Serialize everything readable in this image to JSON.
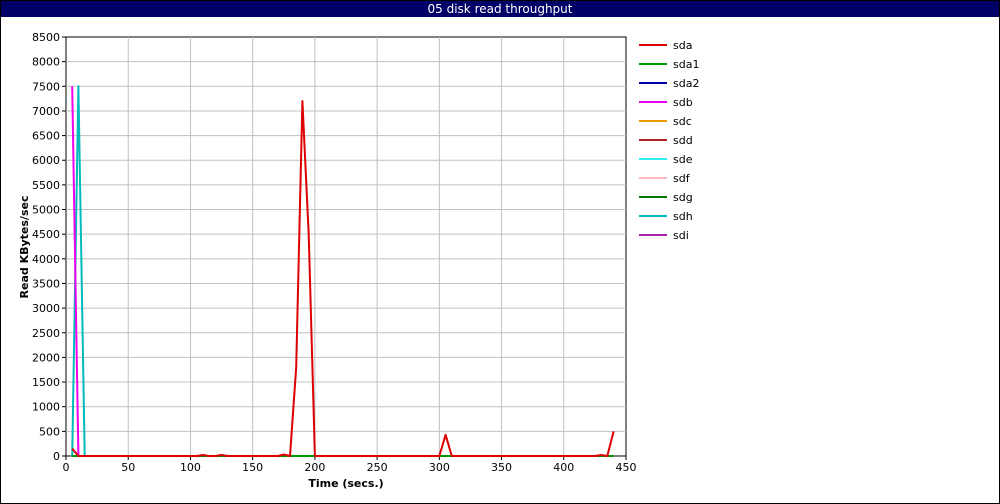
{
  "chart_data": {
    "type": "line",
    "title": "05 disk read throughput",
    "xlabel": "Time (secs.)",
    "ylabel": "Read KBytes/sec",
    "xlim": [
      0,
      450
    ],
    "ylim": [
      0,
      8500
    ],
    "x_ticks": [
      0,
      50,
      100,
      150,
      200,
      250,
      300,
      350,
      400,
      450
    ],
    "y_ticks": [
      0,
      500,
      1000,
      1500,
      2000,
      2500,
      3000,
      3500,
      4000,
      4500,
      5000,
      5500,
      6000,
      6500,
      7000,
      7500,
      8000,
      8500
    ],
    "grid": true,
    "legend_position": "right",
    "series": [
      {
        "name": "sda",
        "color": "#dd0000",
        "x": [
          5,
          10,
          15,
          20,
          25,
          30,
          35,
          40,
          45,
          50,
          55,
          60,
          65,
          70,
          75,
          80,
          85,
          90,
          95,
          100,
          105,
          110,
          115,
          120,
          125,
          130,
          135,
          140,
          145,
          150,
          155,
          160,
          165,
          170,
          175,
          180,
          185,
          190,
          195,
          200,
          205,
          210,
          215,
          220,
          225,
          230,
          235,
          240,
          245,
          250,
          255,
          260,
          265,
          270,
          275,
          280,
          285,
          290,
          295,
          300,
          305,
          310,
          315,
          320,
          325,
          330,
          335,
          340,
          345,
          350,
          355,
          360,
          365,
          370,
          375,
          380,
          385,
          390,
          395,
          400,
          405,
          410,
          415,
          420,
          425,
          430,
          435,
          440
        ],
        "values": [
          150,
          0,
          0,
          0,
          0,
          0,
          0,
          0,
          0,
          0,
          0,
          0,
          0,
          0,
          0,
          0,
          0,
          0,
          0,
          0,
          0,
          20,
          0,
          0,
          20,
          0,
          0,
          0,
          0,
          0,
          0,
          0,
          0,
          0,
          30,
          0,
          1800,
          7200,
          4500,
          0,
          0,
          0,
          0,
          0,
          0,
          0,
          0,
          0,
          0,
          0,
          0,
          0,
          0,
          0,
          0,
          0,
          0,
          0,
          0,
          0,
          430,
          0,
          0,
          0,
          0,
          0,
          0,
          0,
          0,
          0,
          0,
          0,
          0,
          0,
          0,
          0,
          0,
          0,
          0,
          0,
          0,
          0,
          0,
          0,
          0,
          20,
          0,
          500
        ]
      },
      {
        "name": "sda1",
        "color": "#009900",
        "x": [
          5,
          440
        ],
        "values": [
          0,
          0
        ]
      },
      {
        "name": "sda2",
        "color": "#0000aa",
        "x": [
          5,
          440
        ],
        "values": [
          0,
          0
        ]
      },
      {
        "name": "sdb",
        "color": "#ee00ee",
        "x": [
          5,
          10,
          15,
          440
        ],
        "values": [
          7500,
          0,
          0,
          0
        ]
      },
      {
        "name": "sdc",
        "color": "#ee9900",
        "x": [
          5,
          440
        ],
        "values": [
          0,
          0
        ]
      },
      {
        "name": "sdd",
        "color": "#aa2222",
        "x": [
          5,
          440
        ],
        "values": [
          0,
          0
        ]
      },
      {
        "name": "sde",
        "color": "#33eeee",
        "x": [
          5,
          440
        ],
        "values": [
          0,
          0
        ]
      },
      {
        "name": "sdf",
        "color": "#ffbbbb",
        "x": [
          5,
          440
        ],
        "values": [
          0,
          0
        ]
      },
      {
        "name": "sdg",
        "color": "#007700",
        "x": [
          5,
          440
        ],
        "values": [
          0,
          0
        ]
      },
      {
        "name": "sdh",
        "color": "#00bbbb",
        "x": [
          5,
          10,
          15,
          20,
          440
        ],
        "values": [
          0,
          7500,
          0,
          0,
          0
        ]
      },
      {
        "name": "sdi",
        "color": "#aa22aa",
        "x": [
          5,
          440
        ],
        "values": [
          0,
          0
        ]
      }
    ]
  }
}
